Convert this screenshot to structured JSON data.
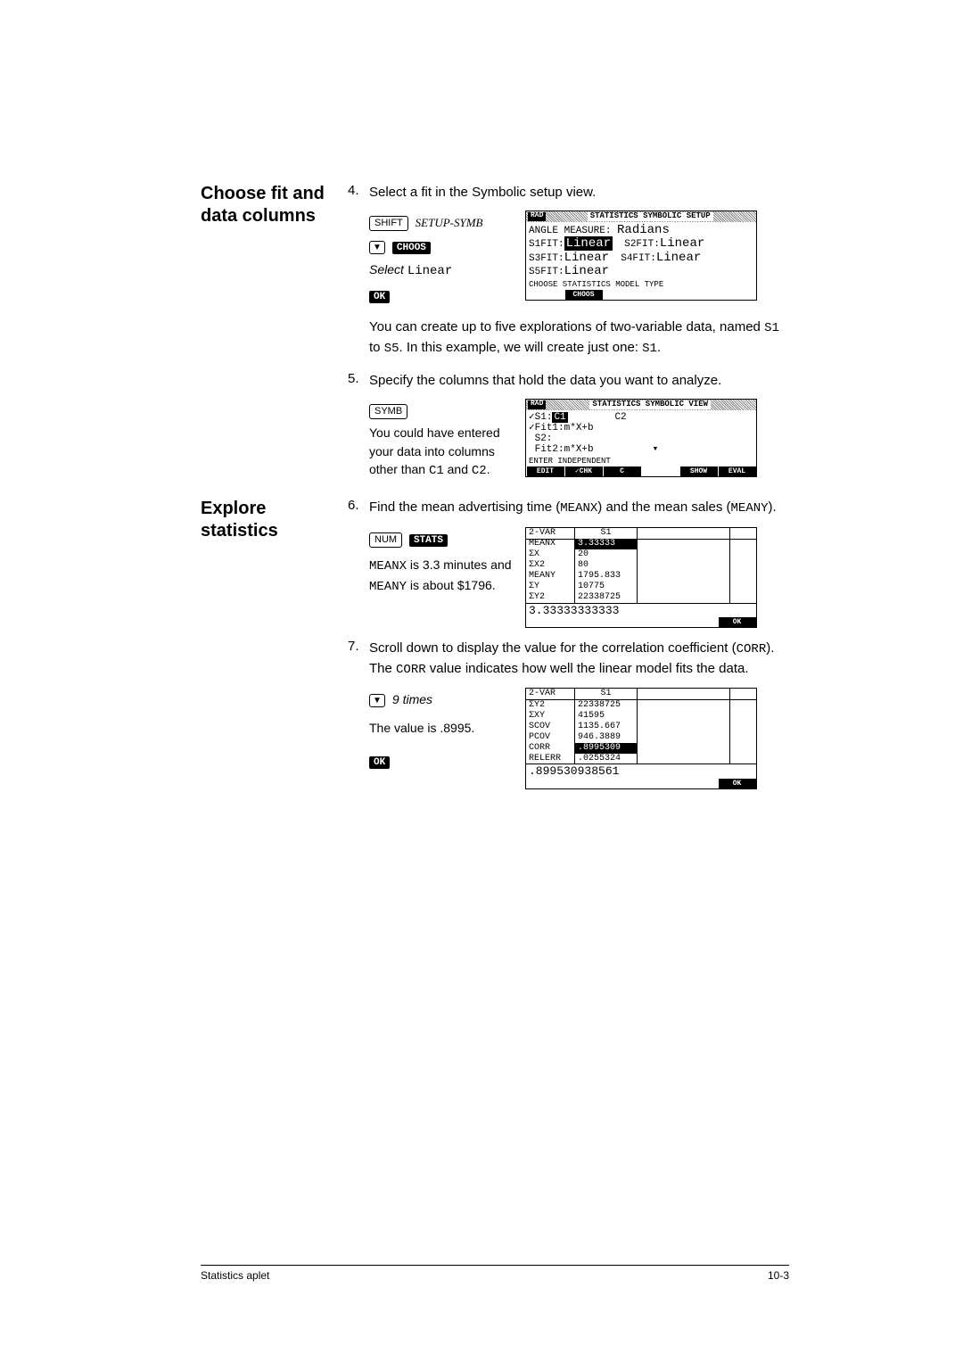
{
  "sidebar": {
    "h1": "Choose fit and data columns",
    "h2": "Explore statistics"
  },
  "steps": {
    "s4": {
      "n": "4.",
      "t": "Select a fit in the Symbolic setup view."
    },
    "s4_after": "You can create up to five explorations of two-variable data, named S1 to S5. In this example, we will create just one: S1.",
    "s5": {
      "n": "5.",
      "t": "Specify the columns that hold the data you want to analyze."
    },
    "s5_note": "You could have entered your data into columns other than C1 and C2.",
    "s6": {
      "n": "6.",
      "t": "Find the mean advertising time (MEANX) and the mean sales (MEANY)."
    },
    "s6_note": "MEANX is 3.3 minutes and MEANY is about $1796.",
    "s7": {
      "n": "7.",
      "t": "Scroll down to display the value for the correlation coefficient (CORR). The CORR value indicates how well the linear model fits the data."
    },
    "s7_act": "9 times",
    "s7_note": "The value is .8995."
  },
  "keys": {
    "shift": "SHIFT",
    "setup_symb": "SETUP-SYMB",
    "select_linear_a": "Select ",
    "select_linear_b": "Linear",
    "choos": "CHOOS",
    "ok": "OK",
    "symb": "SYMB",
    "num": "NUM",
    "stats": "STATS",
    "down": "▼"
  },
  "calc1": {
    "badge": "RAD",
    "title": "STATISTICS SYMBOLIC SETUP",
    "angle_lbl": "ANGLE MEASURE:",
    "angle_val": "Radians",
    "s1l": "S1FIT:",
    "s1v": "Linear",
    "s2l": "S2FIT:",
    "s2v": "Linear",
    "s3l": "S3FIT:",
    "s3v": "Linear",
    "s4l": "S4FIT:",
    "s4v": "Linear",
    "s5l": "S5FIT:",
    "s5v": "Linear",
    "msg": "CHOOSE STATISTICS MODEL TYPE",
    "menu": [
      "",
      "CHOOS",
      "",
      "",
      "",
      ""
    ]
  },
  "calc2": {
    "badge": "RAD",
    "title": "STATISTICS SYMBOLIC VIEW",
    "r1": "✓S1:",
    "r1v": "C1",
    "r1b": "C2",
    "r2": "✓Fit1:m*X+b",
    "r3": " S2:",
    "r4": " Fit2:m*X+b",
    "msg": "ENTER INDEPENDENT",
    "menu": [
      "EDIT",
      "✓CHK",
      " C ",
      "",
      "SHOW",
      "EVAL"
    ]
  },
  "stats1": {
    "hdr0": "2-VAR",
    "hdr1": "S1",
    "rows": [
      [
        "MEANX",
        "3.33333"
      ],
      [
        "ΣX",
        "20"
      ],
      [
        "ΣX2",
        "80"
      ],
      [
        "MEANY",
        "1795.833"
      ],
      [
        "ΣY",
        "10775"
      ],
      [
        "ΣY2",
        "22338725"
      ]
    ],
    "big": "3.33333333333",
    "menu": [
      "",
      "",
      "",
      "",
      "",
      "OK"
    ]
  },
  "stats2": {
    "hdr0": "2-VAR",
    "hdr1": "S1",
    "rows": [
      [
        "ΣY2",
        "22338725"
      ],
      [
        "ΣXY",
        "41595"
      ],
      [
        "SCOV",
        "1135.667"
      ],
      [
        "PCOV",
        "946.3889"
      ],
      [
        "CORR",
        ".8995309"
      ],
      [
        "RELERR",
        ".0255324"
      ]
    ],
    "big": ".899530938561",
    "menu": [
      "",
      "",
      "",
      "",
      "",
      "OK"
    ]
  },
  "footer": {
    "left": "Statistics aplet",
    "right": "10-3"
  }
}
